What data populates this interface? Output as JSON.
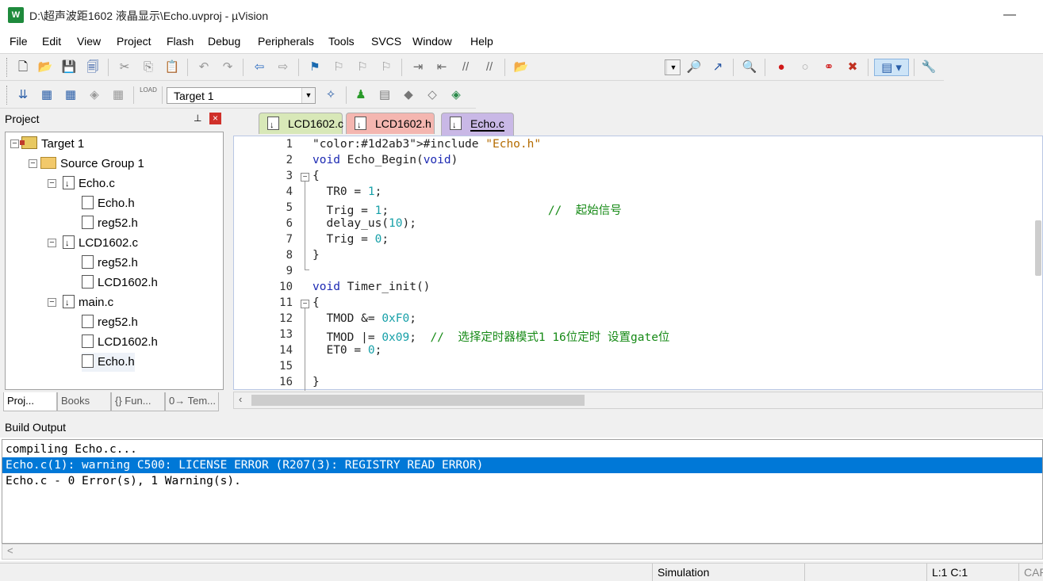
{
  "window": {
    "title": "D:\\超声波距1602 液晶显示\\Echo.uvproj - µVision",
    "logo_text": "W",
    "minimize_glyph": "—"
  },
  "menu": [
    "File",
    "Edit",
    "View",
    "Project",
    "Flash",
    "Debug",
    "Peripherals",
    "Tools",
    "SVCS",
    "Window",
    "Help"
  ],
  "toolbar2": {
    "target_select": "Target 1",
    "load_label": "LOAD"
  },
  "project_panel": {
    "title": "Project",
    "pin_glyph": "⊥",
    "close_glyph": "×",
    "tree": {
      "target": "Target 1",
      "group": "Source Group 1",
      "files": [
        {
          "name": "Echo.c",
          "children": [
            "Echo.h",
            "reg52.h"
          ]
        },
        {
          "name": "LCD1602.c",
          "children": [
            "reg52.h",
            "LCD1602.h"
          ]
        },
        {
          "name": "main.c",
          "children": [
            "reg52.h",
            "LCD1602.h",
            "Echo.h"
          ]
        }
      ]
    },
    "tabs": [
      "Proj...",
      "Books",
      "{} Fun...",
      "0→ Tem..."
    ]
  },
  "editor": {
    "tabs": [
      {
        "label": "LCD1602.c",
        "color": "#d8e8b8"
      },
      {
        "label": "LCD1602.h",
        "color": "#f4b6b0"
      },
      {
        "label": "Echo.c",
        "color": "#c9b8e6"
      }
    ],
    "line_numbers": [
      "1",
      "2",
      "3",
      "4",
      "5",
      "6",
      "7",
      "8",
      "9",
      "10",
      "11",
      "12",
      "13",
      "14",
      "15",
      "16"
    ],
    "code": [
      "#include \"Echo.h\"",
      "void Echo_Begin(void)",
      "{",
      "  TR0 = 1;",
      "  Trig = 1;                       //  起始信号",
      "  delay_us(10);",
      "  Trig = 0;",
      "}",
      "",
      "void Timer_init()",
      "{",
      "  TMOD &= 0xF0;",
      "  TMOD |= 0x09;  //  选择定时器模式1 16位定时 设置gate位",
      "  ET0 = 0;",
      "",
      "}"
    ]
  },
  "build_output": {
    "title": "Build Output",
    "lines": [
      "compiling Echo.c...",
      "Echo.c(1): warning C500: LICENSE ERROR (R207(3): REGISTRY READ ERROR)",
      "Echo.c - 0 Error(s), 1 Warning(s)."
    ],
    "selected_index": 1,
    "scroll_left_glyph": "<"
  },
  "status": {
    "mode": "Simulation",
    "position": "L:1 C:1",
    "caps": "CAP"
  },
  "colors": {
    "selection": "#0078d7",
    "keyword": "#1d2ab3",
    "number": "#17a0a8",
    "string": "#b46b00",
    "comment": "#168a16"
  }
}
